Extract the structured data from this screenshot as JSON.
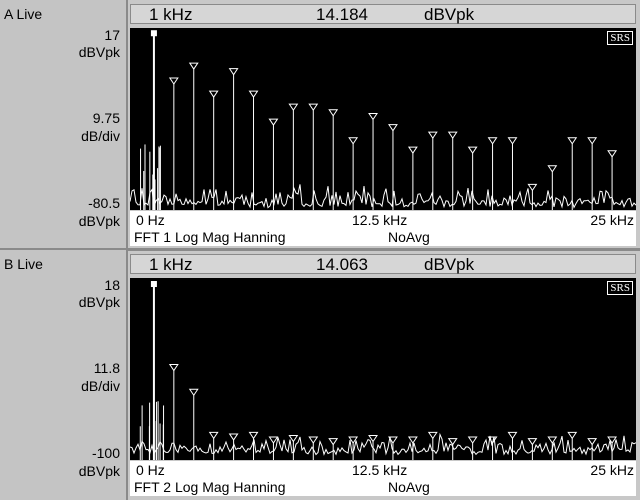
{
  "colors": {
    "trace": "#ffffff",
    "plot_bg": "#000000",
    "panel_bg": "#c4c4c4"
  },
  "panelA": {
    "live_label": "A Live",
    "ytop": "17",
    "ytop_unit": "dBVpk",
    "ymid": "9.75",
    "ymid_unit": "dB/div",
    "ybot": "-80.5",
    "ybot_unit": "dBVpk",
    "marker_freq": "1 kHz",
    "marker_value": "14.184",
    "marker_unit": "dBVpk",
    "badge": "SRS",
    "x_start": "0 Hz",
    "x_mid": "12.5 kHz",
    "x_end": "25 kHz",
    "footer_left": "FFT 1 Log Mag Hanning",
    "footer_right": "NoAvg"
  },
  "panelB": {
    "live_label": "B Live",
    "ytop": "18",
    "ytop_unit": "dBVpk",
    "ymid": "11.8",
    "ymid_unit": "dB/div",
    "ybot": "-100",
    "ybot_unit": "dBVpk",
    "marker_freq": "1 kHz",
    "marker_value": "14.063",
    "marker_unit": "dBVpk",
    "badge": "SRS",
    "x_start": "0 Hz",
    "x_mid": "12.5 kHz",
    "x_end": "25 kHz",
    "footer_left": "FFT 2 Log Mag Hanning",
    "footer_right": "NoAvg"
  },
  "chart_data": [
    {
      "type": "line",
      "title": "FFT 1 Log Mag Hanning",
      "xlim_hz": [
        0,
        25000
      ],
      "ylim_dbvpk": [
        -80.5,
        17
      ],
      "fundamental": {
        "freq_hz": 1000,
        "level_dbvpk": 14.184
      },
      "harmonic_peaks": {
        "freq_khz": [
          1,
          2,
          3,
          4,
          5,
          6,
          7,
          8,
          9,
          10,
          11,
          12,
          13,
          14,
          15,
          16,
          17,
          18,
          19,
          20,
          21,
          22,
          23,
          24
        ],
        "level_dbvpk": [
          14.2,
          -13,
          -5,
          -20,
          -8,
          -20,
          -35,
          -27,
          -27,
          -30,
          -45,
          -32,
          -38,
          -50,
          -42,
          -42,
          -50,
          -45,
          -45,
          -70,
          -60,
          -45,
          -45,
          -52
        ]
      },
      "noise_floor_dbvpk": -76
    },
    {
      "type": "line",
      "title": "FFT 2 Log Mag Hanning",
      "xlim_hz": [
        0,
        25000
      ],
      "ylim_dbvpk": [
        -100,
        18
      ],
      "fundamental": {
        "freq_hz": 1000,
        "level_dbvpk": 14.063
      },
      "harmonic_peaks": {
        "freq_khz": [
          1,
          2,
          3,
          4,
          5,
          6,
          7,
          8,
          9,
          10,
          11,
          12,
          13,
          14,
          15,
          16,
          17,
          18,
          19,
          20,
          21,
          22,
          23,
          24
        ],
        "level_dbvpk": [
          14.1,
          -42,
          -58,
          -86,
          -87,
          -86,
          -89,
          -88,
          -89,
          -90,
          -89,
          -88,
          -89,
          -89,
          -86,
          -90,
          -89,
          -89,
          -86,
          -90,
          -89,
          -86,
          -90,
          -89
        ]
      },
      "noise_floor_dbvpk": -93
    }
  ]
}
